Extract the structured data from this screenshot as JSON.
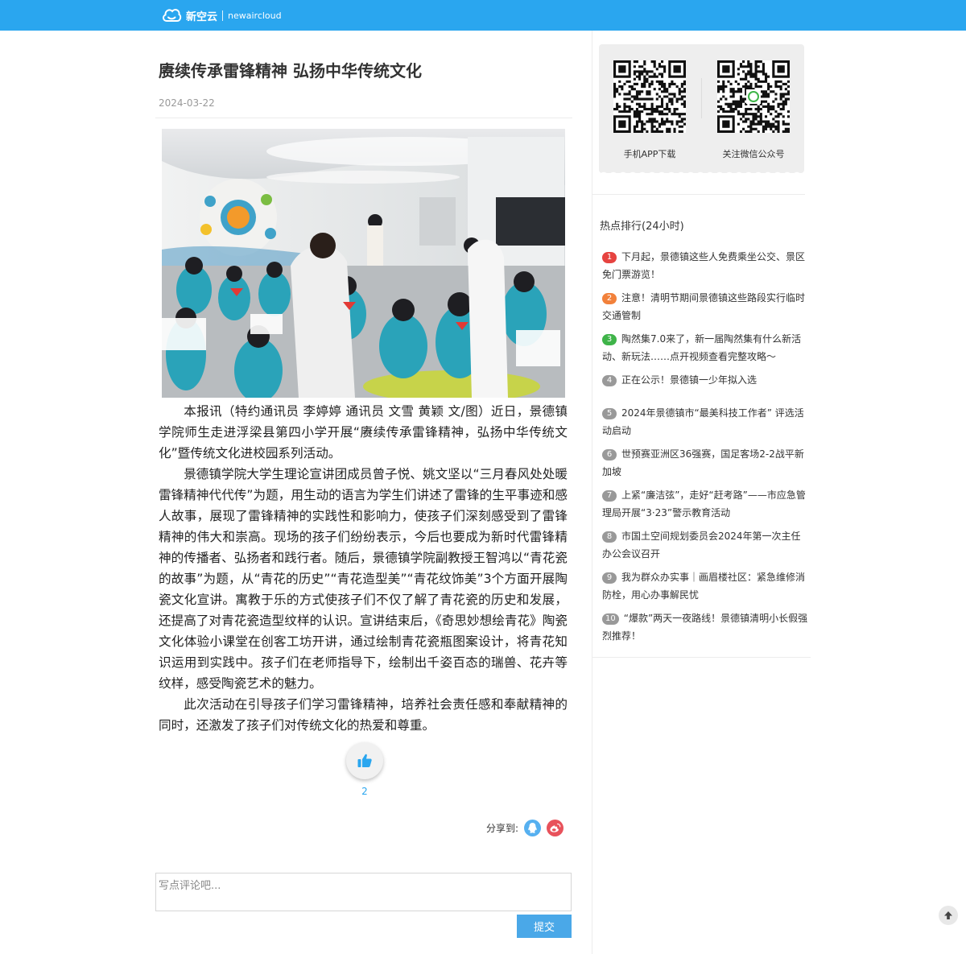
{
  "header": {
    "logo_cn": "新空云",
    "logo_en": "newaircloud",
    "brand_color": "#2aa6ef"
  },
  "article": {
    "title": "赓续传承雷锋精神  弘扬中华传统文化",
    "date": "2024-03-22",
    "paragraphs": [
      "本报讯（特约通讯员 李婷婷 通讯员 文雪 黄颖 文/图）近日，景德镇学院师生走进浮梁县第四小学开展“赓续传承雷锋精神，弘扬中华传统文化”暨传统文化进校园系列活动。",
      "景德镇学院大学生理论宣讲团成员曾子悦、姚文坚以“三月春风处处暖 雷锋精神代代传”为题，用生动的语言为学生们讲述了雷锋的生平事迹和感人故事，展现了雷锋精神的实践性和影响力，使孩子们深刻感受到了雷锋精神的伟大和崇高。现场的孩子们纷纷表示，今后也要成为新时代雷锋精神的传播者、弘扬者和践行者。随后，景德镇学院副教授王智鸿以“青花瓷的故事”为题，从“青花的历史”“青花造型美”“青花纹饰美”3个方面开展陶瓷文化宣讲。寓教于乐的方式使孩子们不仅了解了青花瓷的历史和发展，还提高了对青花瓷造型纹样的认识。宣讲结束后，《奇思妙想绘青花》陶瓷文化体验小课堂在创客工坊开讲，通过绘制青花瓷瓶图案设计，将青花知识运用到实践中。孩子们在老师指导下，绘制出千姿百态的瑞兽、花卉等纹样，感受陶瓷艺术的魅力。",
      "此次活动在引导孩子们学习雷锋精神，培养社会责任感和奉献精神的同时，还激发了孩子们对传统文化的热爱和尊重。"
    ],
    "like_count": "2",
    "share_label": "分享到:",
    "share_icons": [
      "qq-icon",
      "weibo-icon"
    ]
  },
  "comment": {
    "placeholder": "写点评论吧...",
    "submit_label": "提交"
  },
  "sidebar": {
    "qr": [
      {
        "label": "手机APP下载"
      },
      {
        "label": "关注微信公众号"
      }
    ],
    "hot_title": "热点排行(24小时)",
    "hot_items": [
      {
        "rank": "1",
        "text": "下月起，景德镇这些人免费乘坐公交、景区免门票游览！",
        "color": "#e64340"
      },
      {
        "rank": "2",
        "text": "注意！清明节期间景德镇这些路段实行临时交通管制",
        "color": "#f2813b"
      },
      {
        "rank": "3",
        "text": "陶然集7.0来了，新一届陶然集有什么新活动、新玩法……点开视频查看完整攻略～",
        "color": "#3fb449"
      },
      {
        "rank": "4",
        "text": "正在公示！景德镇一少年拟入选",
        "color": "#999999"
      },
      {
        "rank": "5",
        "text": "2024年景德镇市“最美科技工作者” 评选活动启动",
        "color": "#999999"
      },
      {
        "rank": "6",
        "text": "世预赛亚洲区36强赛，国足客场2-2战平新加坡",
        "color": "#999999"
      },
      {
        "rank": "7",
        "text": "上紧“廉洁弦”，走好“赶考路”——市应急管理局开展“3·23”警示教育活动",
        "color": "#999999"
      },
      {
        "rank": "8",
        "text": "市国土空间规划委员会2024年第一次主任办公会议召开",
        "color": "#999999"
      },
      {
        "rank": "9",
        "text": "我为群众办实事｜画眉楼社区：紧急维修消防栓，用心办事解民忧",
        "color": "#999999"
      },
      {
        "rank": "10",
        "text": "“爆款”两天一夜路线！景德镇清明小长假强烈推荐！",
        "color": "#999999"
      }
    ]
  }
}
